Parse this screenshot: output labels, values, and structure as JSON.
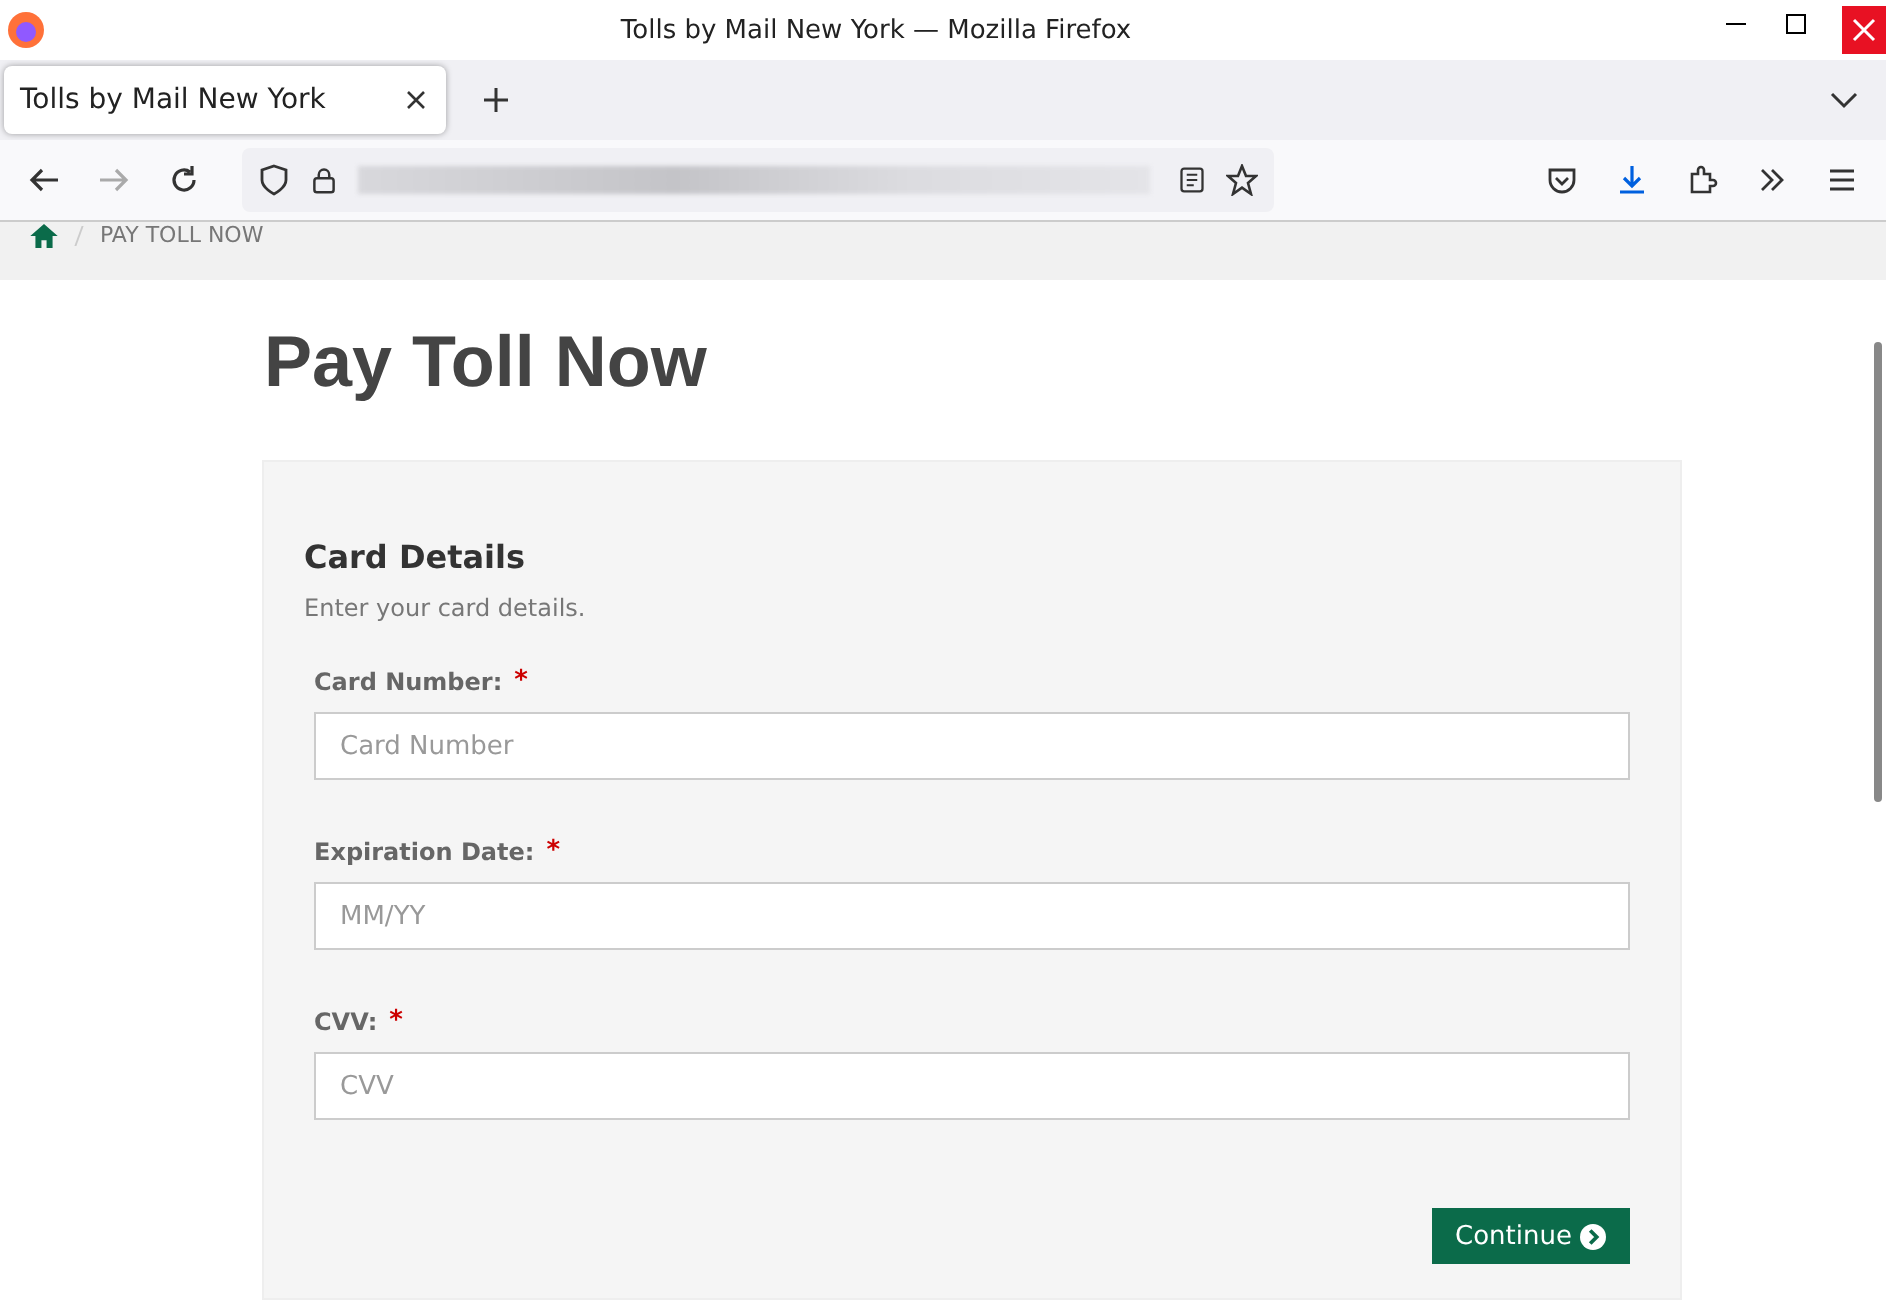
{
  "window": {
    "title": "Tolls by Mail New York — Mozilla Firefox"
  },
  "tabs": [
    {
      "label": "Tolls by Mail New York",
      "selected": true
    }
  ],
  "breadcrumb": {
    "current": "PAY TOLL NOW"
  },
  "page": {
    "heading": "Pay Toll Now"
  },
  "card": {
    "title": "Card Details",
    "subtitle": "Enter your card details.",
    "fields": [
      {
        "label": "Card Number:",
        "required": true,
        "placeholder": "Card Number"
      },
      {
        "label": "Expiration Date:",
        "required": true,
        "placeholder": "MM/YY"
      },
      {
        "label": "CVV:",
        "required": true,
        "placeholder": "CVV"
      }
    ],
    "required_mark": "*",
    "button": "Continue"
  }
}
